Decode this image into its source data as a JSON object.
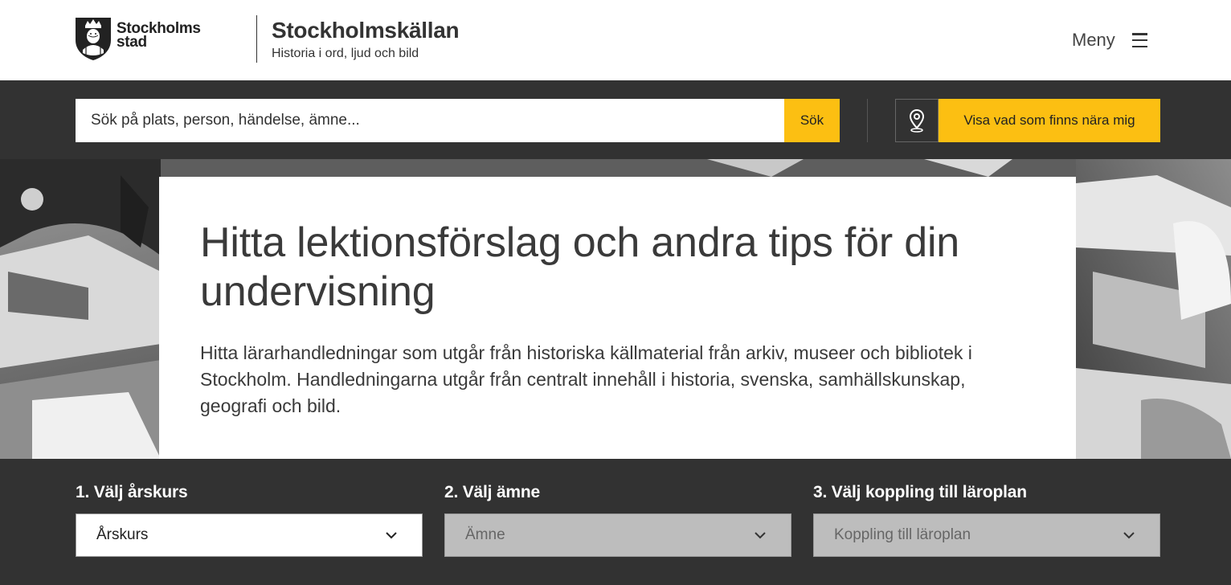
{
  "header": {
    "logo_line1": "Stockholms",
    "logo_line2": "stad",
    "site_title": "Stockholmskällan",
    "site_tagline": "Historia i ord, ljud och bild",
    "menu_label": "Meny"
  },
  "search": {
    "placeholder": "Sök på plats, person, händelse, ämne...",
    "button_label": "Sök",
    "near_me_label": "Visa vad som finns nära mig"
  },
  "hero": {
    "title": "Hitta lektionsförslag och andra tips för din undervisning",
    "text": "Hitta lärarhandledningar som utgår från historiska källmaterial från arkiv, museer och bibliotek i Stockholm. Handledningarna utgår från centralt innehåll i historia, svenska, samhällskunskap, geografi och bild."
  },
  "filters": [
    {
      "label": "1. Välj årskurs",
      "value": "Årskurs",
      "enabled": true
    },
    {
      "label": "2. Välj ämne",
      "value": "Ämne",
      "enabled": false
    },
    {
      "label": "3. Välj koppling till läroplan",
      "value": "Koppling till läroplan",
      "enabled": false
    }
  ],
  "colors": {
    "accent_yellow": "#fcbf12",
    "dark_bar": "#323232",
    "text_dark": "#3a3a3a",
    "disabled_select": "#bdbdbd"
  },
  "icons": {
    "logo": "stockholm-crest-icon",
    "menu": "hamburger-icon",
    "location": "map-pin-icon",
    "dropdown": "chevron-down-icon"
  }
}
